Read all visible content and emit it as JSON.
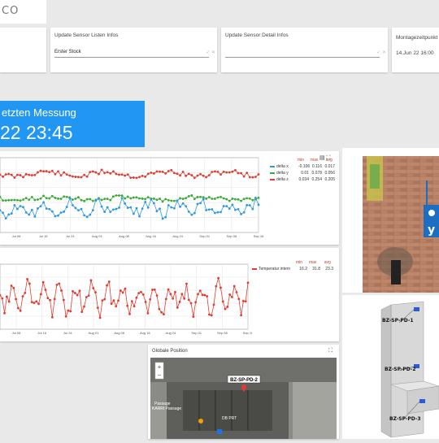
{
  "header": {
    "logo_text": "CO"
  },
  "cards": {
    "list_infos": {
      "title": "Update Sensor Listen Infos",
      "value": "Erster Stock",
      "icons": "✓ ✕"
    },
    "detail_infos": {
      "title": "Update Sensor Detail Infos",
      "value": "",
      "icons": "✓ ✕"
    },
    "mount_time": {
      "title": "Montagezeitpunkt",
      "value": "14.Jun 22 16:00"
    }
  },
  "last_measurement": {
    "title": "etzten Messung",
    "value": "22 23:45"
  },
  "chart1": {
    "tool_icons": "▤ ⛶",
    "legend_headers": [
      "min",
      "max",
      "avg"
    ],
    "legend_rows": [
      {
        "name": "delta x",
        "color": "#2e9adc",
        "min": "-0.106",
        "max": "0.116",
        "avg": "0.017"
      },
      {
        "name": "delta y",
        "color": "#3aaa35",
        "min": "0.01",
        "max": "0.078",
        "avg": "0.056"
      },
      {
        "name": "delta z",
        "color": "#e03c31",
        "min": "0.034",
        "max": "0.254",
        "avg": "0.205"
      }
    ],
    "x_ticks": [
      "Jul 08",
      "Jul 16",
      "Jul 24",
      "Aug 01",
      "Aug 08",
      "Aug 16",
      "Aug 24",
      "Sep 01",
      "Sep 08",
      "Sep 16"
    ]
  },
  "chart2": {
    "legend_headers": [
      "min",
      "max",
      "avg"
    ],
    "legend_rows": [
      {
        "name": "Temperatur intern",
        "color": "#e03c31",
        "min": "16.2",
        "max": "31.8",
        "avg": "23.3"
      }
    ],
    "x_ticks": [
      "Jul 08",
      "Jul 16",
      "Jul 24",
      "Aug 01",
      "Aug 08",
      "Aug 16",
      "Aug 24",
      "Sep 01",
      "Sep 08",
      "Sep 16"
    ]
  },
  "map": {
    "title": "Globale Position",
    "marker_label": "BZ-SP-PD-2",
    "place_labels": [
      "Passage",
      "DB PRT",
      "KARRI Passage"
    ],
    "zoom_in": "+",
    "zoom_out": "−",
    "expand_icon": "⛶"
  },
  "diagram": {
    "labels": [
      "BZ-SP-PD-1",
      "BZ-SP-PD-2",
      "BZ-SP-PD-3"
    ]
  },
  "colors": {
    "accent_blue": "#2196f3",
    "red": "#e03c31",
    "green": "#3aaa35",
    "blue_series": "#2e9adc"
  }
}
